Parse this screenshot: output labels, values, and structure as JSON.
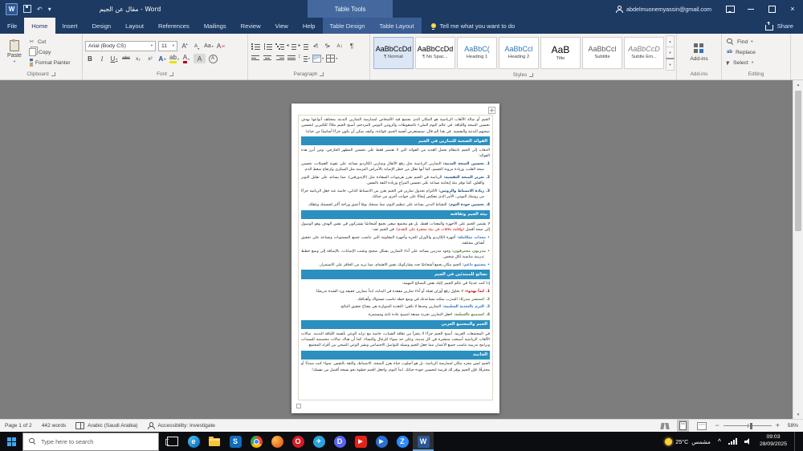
{
  "colors": {
    "titlebar": "#1d3a63",
    "contextual": "#44699f",
    "contextual-tabs": "#3a5d94",
    "ribbon-bg": "#f3f2f1",
    "doc-bg": "#7d7d7d",
    "headerbar": "#2b8fc0",
    "taskbar": "#0c0d10",
    "status-bg": "#f3f3f3",
    "accent": "#2b579a",
    "red": "#c00000",
    "green": "#538135",
    "blue": "#1f4e79"
  },
  "icons": {
    "caret": "▾",
    "up": "▲",
    "down": "▼",
    "pilcrow": "¶",
    "scissors": "✂",
    "undo": "↶",
    "close": "×",
    "bold": "B",
    "italic": "I",
    "underline": "U",
    "strike": "abc",
    "subscript": "x₂",
    "superscript": "x²",
    "grow": "A",
    "shrink": "A",
    "case": "Aa",
    "clear": "A",
    "effects": "A",
    "highlight": "ab",
    "fontcolor": "A",
    "charshade": "A",
    "enclose": "A",
    "sort": "A↕",
    "dir_rtl": "◂¶",
    "dir_ltr": "¶▸",
    "chevron_up": "^"
  },
  "titlebar": {
    "title": "مقال عن الجيم  -  Word",
    "context_title": "Table Tools",
    "account": "abdelmuonemyassin@gmail.com"
  },
  "ribbon": {
    "tabs": [
      "File",
      "Home",
      "Insert",
      "Design",
      "Layout",
      "References",
      "Mailings",
      "Review",
      "View",
      "Help"
    ],
    "contextual_tabs": [
      "Table Design",
      "Table Layout"
    ],
    "tell_me": "Tell me what you want to do",
    "share": "Share",
    "clipboard": {
      "label": "Clipboard",
      "paste": "Paste",
      "cut": "Cut",
      "copy": "Copy",
      "format_painter": "Format Painter"
    },
    "font": {
      "label": "Font",
      "family": "Arial (Body CS)",
      "size": "11"
    },
    "paragraph": {
      "label": "Paragraph"
    },
    "styles": {
      "label": "Styles",
      "items": [
        {
          "preview": "AaBbCcDd",
          "label": "¶ Normal",
          "style": "color:#000000"
        },
        {
          "preview": "AaBbCcDd",
          "label": "¶ No Spac...",
          "style": "color:#000000"
        },
        {
          "preview": "AaBbC(",
          "label": "Heading 1",
          "style": "color:#2e74b5"
        },
        {
          "preview": "AaBbCcl",
          "label": "Heading 2",
          "style": "color:#2e74b5"
        },
        {
          "preview": "AaB",
          "label": "Title",
          "style": "color:#000000;font-size:12px"
        },
        {
          "preview": "AaBbCcl",
          "label": "Subtitle",
          "style": "color:#5a5a5a"
        },
        {
          "preview": "AaBbCcD",
          "label": "Subtle Em...",
          "style": "color:#7f7f7f;font-style:italic"
        }
      ]
    },
    "addins": {
      "label": "Add-ins",
      "button": "Add-ins"
    },
    "editing": {
      "label": "Editing",
      "find": "Find",
      "replace": "Replace",
      "select": "Select"
    }
  },
  "doc": {
    "intro": "الجيم أو صالة الألعاب الرياضية هو المكان الذي يجتمع فيه الأشخاص لممارسة التمارين البدنية بمختلف أنواعها بهدف تحسين الصحة واللياقة. في عالم اليوم المليء بالضغوطات والروتين اليومي المزدحم، أصبح الجيم ملاذًا للكثيرين لتحسين صحتهم البدنية والنفسية. في هذا الم قال، سنستعرض أهمية الجيم، فوائده، وكيف يمكن أن يكون جزءًا أساسيًا من حياتنا.",
    "sections": [
      {
        "title": "الفوائد الصحية للتمارين في الجيم",
        "lead": "الذهاب إلى الجيم بانتظام يحمل العديد من الفوائد التي لا تقتصر فقط على تحسين المظهر الخارجي، ومن أبرز هذه الفوائد:",
        "items": [
          {
            "num": "1.",
            "style": "color:#1f4e79",
            "title": "تحسين الصحة البدنية:",
            "text": "التمارين الرياضية مثل رفع الأثقال وتمارين الكارديو تساعد على تقوية العضلات، تحسين صحة القلب، وزيادة مرونة الجسم، كما أنها تقلل من خطر الإصابة بالأمراض المزمنة مثل السكري وارتفاع ضغط الدم."
          },
          {
            "num": "2.",
            "style": "color:#1f4e79",
            "title": "تعزيز الصحة النفسية:",
            "text": "الرياضة في الجيم تفرز هرمونات السعادة مثل (الإندورفين)، مما يساعد على تقليل التوتر والقلق، كما توفر بيئة إيجابية تساعد على تحسين المزاج وزيادة الثقة بالنفس."
          },
          {
            "num": "3.",
            "style": "color:#1f4e79",
            "title": "زيادة الانضباط والروتين:",
            "text": "الالتزام بجدول تمارين في الجيم يعزز من الانضباط الذاتي، خاصة عند جعل الرياضة جزءًا من روتينك اليومي، الأمر الذي ينعكس إيجابًا على جوانب أخرى من حياتك."
          },
          {
            "num": "4.",
            "style": "color:#1f4e79",
            "title": "تحسين جودة النوم:",
            "text": "النشاط البدني يساعد على تنظيم النوم، مما يمنحك نومًا أعمق وراحة أكبر لجسمك وعقلك."
          }
        ]
      },
      {
        "title": "بيئة الجيم وثقافته",
        "lead_parts": [
          {
            "t": "لا يقتصر الجيم على الأجهزة والمعدات فقط، بل هو مجتمع صغير يجمع أشخاصًا يشتركون في نفس الهدف وهو الوصول إلى صحة أفضل ",
            "s": ""
          },
          {
            "t": "(وإقامة علاقات في بيئة محفزة على التقدم)",
            "s": "color:#c00000"
          },
          {
            "t": ". في الجيم تجد:",
            "s": ""
          }
        ],
        "items": [
          {
            "num": "•",
            "style": "color:#2e74b5",
            "title": "معدات متكاملة:",
            "text": "أجهزة الكارديو والأوزان الحرة وأجهزة المقاومة التي تناسب جميع المستويات وتساعد على تحقيق أهداف مختلفة."
          },
          {
            "num": "•",
            "style": "color:#538135",
            "title": "مدربون محترفون:",
            "text": "وجود مدربين يساعد على أداء التمارين بشكل صحيح وتجنب الإصابات، بالإضافة إلى وضع خطط تدريبية مناسبة لكل شخص."
          },
          {
            "num": "•",
            "style": "color:#2e74b5",
            "title": "مجتمع داعم:",
            "text": "الجيم مكان يجمع أشخاصًا جدد يشاركونك نفس الاهتمام، مما يزيد من الحافز على الاستمرار."
          }
        ]
      },
      {
        "title": "نصائح للمبتدئين في الجيم",
        "lead": "إذا كنت جديدًا في عالم الجيم، إليك بعض النصائح المهمة:",
        "items": [
          {
            "num": "1.",
            "style": "color:#c00000",
            "title": "ابدأ بهدوء:",
            "text": "لا تحاول رفع أوزان ثقيلة أو أداء تمارين معقدة في البداية، ابدأ بتمارين خفيفة وزد الشدة تدريجيًا."
          },
          {
            "num": "2.",
            "style": "color:#538135",
            "title": "استشر مدربًا:",
            "text": "المدرب يمكنه مساعدتك في وضع خطة تناسب مستواك وأهدافك."
          },
          {
            "num": "3.",
            "style": "color:#2e74b5",
            "title": "التزم بالتغذية السليمة:",
            "text": "التمارين وحدها لا تكفي؛ التغذية المتوازنة هي مفتاح تحقيق النتائج."
          },
          {
            "num": "4.",
            "style": "color:#538135",
            "title": "استمتع بالعملية:",
            "text": "اجعل التمارين تجربة ممتعة لتصبح عادة ثابتة ومستمرة."
          }
        ]
      },
      {
        "title": "الجيم والمجتمع العربي",
        "lead": "في المجتمعات العربية، أصبح الجيم جزءًا لا يتجزأ من ثقافة الشباب، خاصة مع تزايد الوعي بأهمية اللياقة البدنية. صالات الألعاب الرياضية أصبحت منتشرة في كل مدينة، وعلى حد سواء للرجال والنساء، كما أن هناك صالات مخصصة للسيدات وبرامج تدريبية تناسب جميع الأعمار، مما جعل الجيم وسيلة للتواصل الاجتماعي ونشر الوعي الصحي بين أفراد المجتمع.",
        "items": []
      },
      {
        "title": "الخاتمة",
        "lead": "الجيم ليس مجرد مكان لممارسة الرياضة، بل هو أسلوب حياة يعزز الصحة، الانضباط، والثقة بالنفس. سواء كنت مبتدئًا أو محترفًا، فإن الجيم يوفر لك فرصة لتحسين جودة حياتك. ابدأ اليوم، واجعل الجيم خطوة نحو نسخة أفضل من نفسك!",
        "items": []
      }
    ]
  },
  "statusbar": {
    "page": "Page 1 of 2",
    "words": "442 words",
    "language": "Arabic (Saudi Arabia)",
    "accessibility": "Accessibility: Investigate",
    "zoom": "58%"
  },
  "taskbar": {
    "search_placeholder": "Type here to search",
    "app_icons": [
      {
        "name": "task-view",
        "glyph": ""
      },
      {
        "name": "edge",
        "glyph": "e"
      },
      {
        "name": "file-explorer",
        "glyph": ""
      },
      {
        "name": "store",
        "glyph": "S"
      },
      {
        "name": "chrome",
        "glyph": ""
      },
      {
        "name": "firefox",
        "glyph": ""
      },
      {
        "name": "opera",
        "glyph": "O"
      },
      {
        "name": "telegram",
        "glyph": "✈"
      },
      {
        "name": "discord",
        "glyph": "D"
      },
      {
        "name": "youtube",
        "glyph": "▶"
      },
      {
        "name": "media-player",
        "glyph": "▶"
      },
      {
        "name": "zoom",
        "glyph": "Z"
      }
    ],
    "active_app": {
      "name": "word",
      "glyph": "W"
    },
    "weather_temp": "25°C",
    "weather_desc": "مشمس",
    "time": "09:03",
    "date": "28/09/2025"
  }
}
